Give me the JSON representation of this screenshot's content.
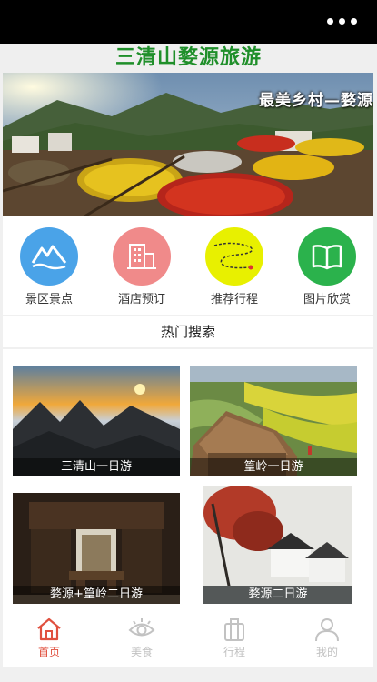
{
  "app": {
    "title": "三清山婺源旅游"
  },
  "banner": {
    "caption": "最美乡村—婺源"
  },
  "quick_links": [
    {
      "label": "景区景点",
      "icon": "mountain-icon",
      "color": "#4aa3e8"
    },
    {
      "label": "酒店预订",
      "icon": "hotel-building-icon",
      "color": "#f08a8a"
    },
    {
      "label": "推荐行程",
      "icon": "route-map-icon",
      "color": "#e8f000"
    },
    {
      "label": "图片欣赏",
      "icon": "book-icon",
      "color": "#2bb24c"
    }
  ],
  "hot_search": {
    "title": "热门搜索"
  },
  "tours": [
    {
      "label": "三清山一日游"
    },
    {
      "label": "篁岭一日游"
    },
    {
      "label": "婺源+篁岭二日游"
    },
    {
      "label": "婺源二日游"
    }
  ],
  "tabs": [
    {
      "label": "首页",
      "icon": "home-icon"
    },
    {
      "label": "美食",
      "icon": "eye-icon"
    },
    {
      "label": "行程",
      "icon": "luggage-icon"
    },
    {
      "label": "我的",
      "icon": "user-icon"
    }
  ],
  "colors": {
    "brand_green": "#1f8f2a",
    "active_tab": "#e0503f",
    "inactive_tab": "#c2c2c2"
  }
}
